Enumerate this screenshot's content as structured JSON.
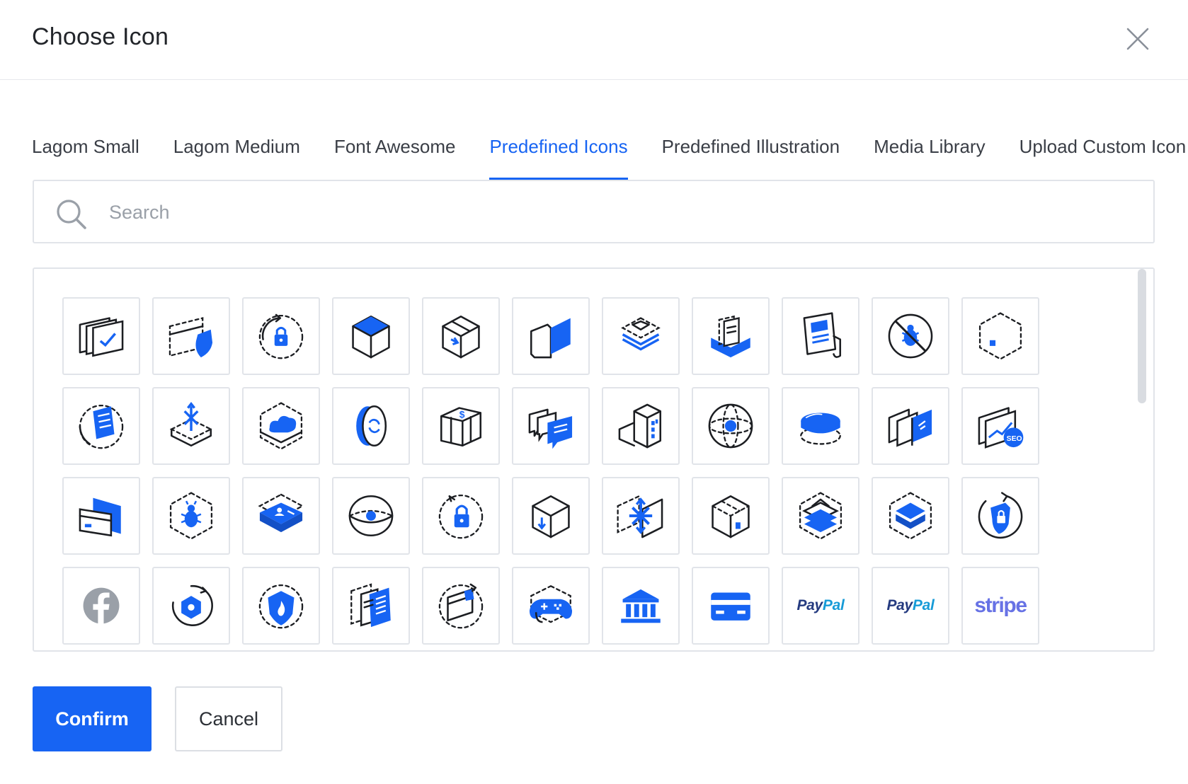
{
  "dialog": {
    "title": "Choose Icon",
    "close_icon": "close-x-icon"
  },
  "tabs": [
    {
      "label": "Lagom Small",
      "active": false
    },
    {
      "label": "Lagom Medium",
      "active": false
    },
    {
      "label": "Font Awesome",
      "active": false
    },
    {
      "label": "Predefined Icons",
      "active": true
    },
    {
      "label": "Predefined Illustration",
      "active": false
    },
    {
      "label": "Media Library",
      "active": false
    },
    {
      "label": "Upload Custom Icon",
      "active": false
    }
  ],
  "search": {
    "placeholder": "Search",
    "value": "",
    "icon": "search-icon"
  },
  "icons": [
    {
      "name": "stacked-cards-check-icon"
    },
    {
      "name": "card-shield-icon"
    },
    {
      "name": "lock-refresh-icon"
    },
    {
      "name": "cube-top-icon"
    },
    {
      "name": "package-arrow-icon"
    },
    {
      "name": "folder-flag-icon"
    },
    {
      "name": "layers-mail-icon"
    },
    {
      "name": "tray-documents-icon"
    },
    {
      "name": "newspaper-icon"
    },
    {
      "name": "no-bug-icon"
    },
    {
      "name": "hexagon-dashed-icon"
    },
    {
      "name": "document-refresh-icon"
    },
    {
      "name": "migration-box-icon"
    },
    {
      "name": "cloud-platform-icon"
    },
    {
      "name": "disc-sync-icon"
    },
    {
      "name": "server-boxes-icon"
    },
    {
      "name": "chat-bubbles-icon"
    },
    {
      "name": "buildings-icon"
    },
    {
      "name": "globe-dot-icon"
    },
    {
      "name": "database-disk-icon"
    },
    {
      "name": "transfer-panels-icon"
    },
    {
      "name": "seo-chart-icon"
    },
    {
      "name": "cards-stack-icon"
    },
    {
      "name": "bug-hexagon-icon"
    },
    {
      "name": "user-platform-icon"
    },
    {
      "name": "eye-sphere-icon"
    },
    {
      "name": "lock-cycle-icon"
    },
    {
      "name": "box-download-icon"
    },
    {
      "name": "move-arrows-icon"
    },
    {
      "name": "cube-dotted-icon"
    },
    {
      "name": "layers-hexagon-icon"
    },
    {
      "name": "stack-hexagon-icon"
    },
    {
      "name": "shield-refresh-icon"
    },
    {
      "name": "facebook-icon"
    },
    {
      "name": "hexagon-cycle-icon"
    },
    {
      "name": "shield-fire-icon"
    },
    {
      "name": "documents-list-icon"
    },
    {
      "name": "window-cycle-icon"
    },
    {
      "name": "gamepad-icon"
    },
    {
      "name": "bank-icon"
    },
    {
      "name": "credit-card-icon"
    },
    {
      "name": "paypal-icon",
      "text": "PayPal"
    },
    {
      "name": "paypal-icon",
      "text": "PayPal"
    },
    {
      "name": "stripe-icon",
      "text": "stripe"
    }
  ],
  "colors": {
    "accent": "#1764f3",
    "ink": "#1f2126",
    "border": "#e1e4e9",
    "paypal_dark": "#253b80",
    "paypal_light": "#179bd7",
    "stripe": "#6772e5",
    "facebook_gray": "#9aa0a8"
  },
  "footer": {
    "confirm_label": "Confirm",
    "cancel_label": "Cancel"
  }
}
